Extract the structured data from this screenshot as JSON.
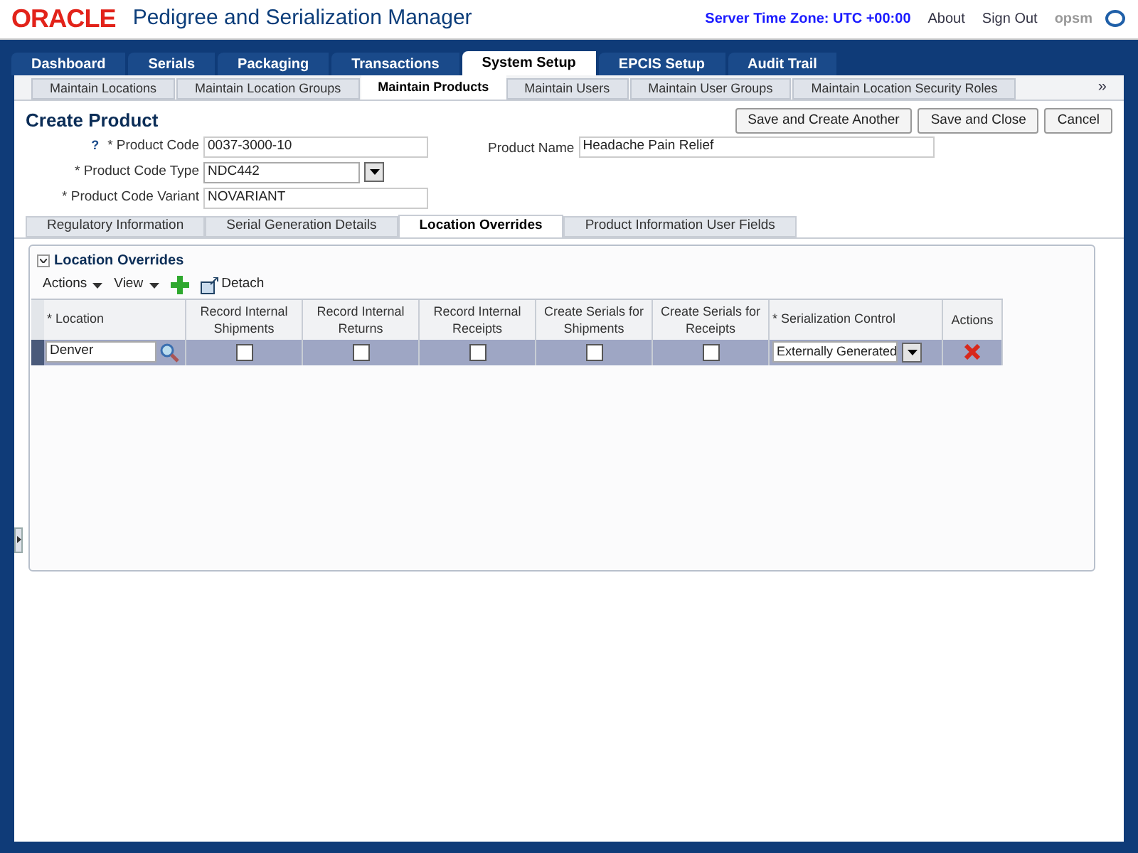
{
  "header": {
    "brand": "ORACLE",
    "app_title": "Pedigree and Serialization Manager",
    "server_time": "Server Time Zone: UTC +00:00",
    "links": [
      "About",
      "Sign Out"
    ],
    "user": "opsm"
  },
  "main_tabs": [
    {
      "label": "Dashboard",
      "selected": false
    },
    {
      "label": "Serials",
      "selected": false
    },
    {
      "label": "Packaging",
      "selected": false
    },
    {
      "label": "Transactions",
      "selected": false
    },
    {
      "label": "System Setup",
      "selected": true
    },
    {
      "label": "EPCIS Setup",
      "selected": false
    },
    {
      "label": "Audit Trail",
      "selected": false
    }
  ],
  "sub_tabs": [
    {
      "label": "Maintain Locations",
      "selected": false
    },
    {
      "label": "Maintain Location Groups",
      "selected": false
    },
    {
      "label": "Maintain Products",
      "selected": true
    },
    {
      "label": "Maintain Users",
      "selected": false
    },
    {
      "label": "Maintain User Groups",
      "selected": false
    },
    {
      "label": "Maintain Location Security Roles",
      "selected": false
    }
  ],
  "sub_tabs_more": "»",
  "page_title": "Create Product",
  "buttons": [
    "Save and Create Another",
    "Save and Close",
    "Cancel"
  ],
  "fields": [
    {
      "label": "* Product Code",
      "value": "0037-3000-10",
      "kind": "text",
      "help": "?"
    },
    {
      "label": "* Product Code Type",
      "value": "NDC442",
      "kind": "select"
    },
    {
      "label": "* Product Code Variant",
      "value": "NOVARIANT",
      "kind": "text"
    }
  ],
  "product_name": {
    "label": "Product Name",
    "value": "Headache Pain Relief"
  },
  "detail_tabs": [
    {
      "label": "Regulatory Information",
      "selected": false
    },
    {
      "label": "Serial Generation Details",
      "selected": false
    },
    {
      "label": "Location Overrides",
      "selected": true
    },
    {
      "label": "Product Information User Fields",
      "selected": false
    }
  ],
  "section": {
    "title": "Location Overrides",
    "expanded": true,
    "toolbar": [
      "Actions",
      "View"
    ],
    "detach": "Detach"
  },
  "table": {
    "columns": [
      {
        "label": "* Location"
      },
      {
        "label": "Record Internal Shipments"
      },
      {
        "label": "Record Internal Returns"
      },
      {
        "label": "Record Internal Receipts"
      },
      {
        "label": "Create Serials for Shipments"
      },
      {
        "label": "Create Serials for Receipts"
      },
      {
        "label": "* Serialization Control"
      },
      {
        "label": "Actions"
      }
    ],
    "rows": [
      {
        "selected": true,
        "location": "Denver",
        "checks": [
          false,
          false,
          false,
          false,
          false
        ],
        "serialization_control": "Externally Generated"
      }
    ]
  }
}
